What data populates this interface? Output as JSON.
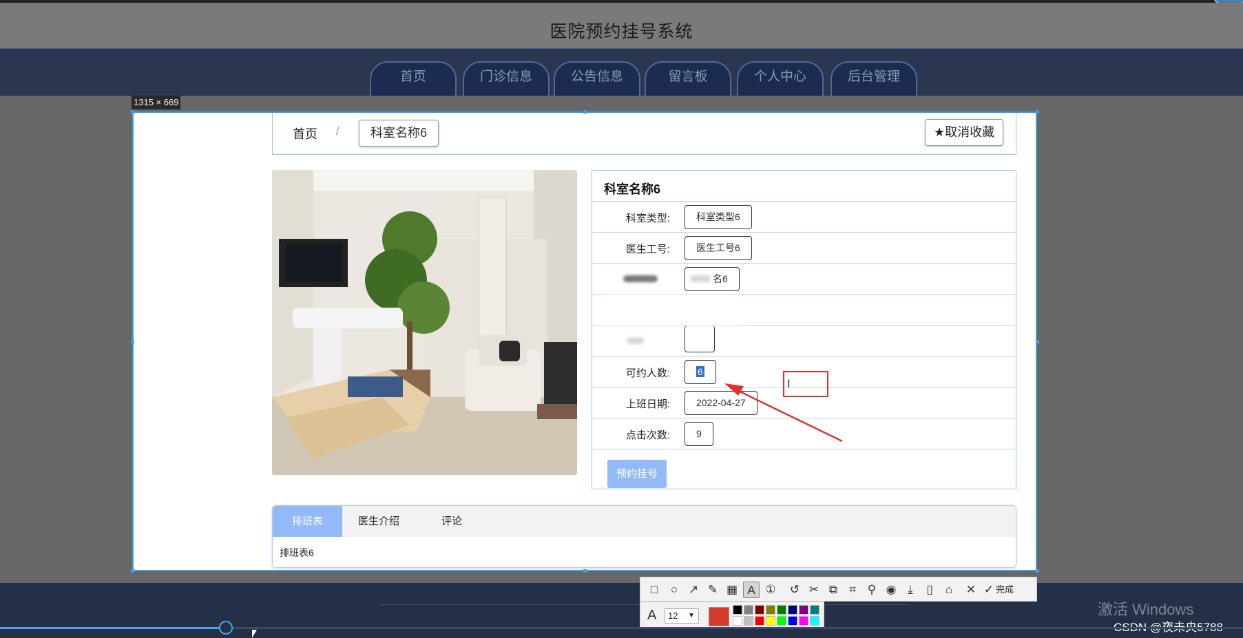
{
  "site": {
    "title": "医院预约挂号系统"
  },
  "nav": [
    "首页",
    "门诊信息",
    "公告信息",
    "留言板",
    "个人中心",
    "后台管理"
  ],
  "selection": {
    "size_label": "1315 × 669"
  },
  "breadcrumb": {
    "home": "首页",
    "separator": "/",
    "current": "科室名称6"
  },
  "favorite_button": {
    "icon": "★",
    "label": "取消收藏"
  },
  "detail": {
    "title": "科室名称6",
    "fields": [
      {
        "label": "科室类型:",
        "value": "科室类型6"
      },
      {
        "label": "医生工号:",
        "value": "医生工号6"
      },
      {
        "label": "",
        "value": "名6"
      },
      {
        "label": "",
        "value": ""
      },
      {
        "label": "",
        "value": ""
      },
      {
        "label": "可约人数:",
        "value": "6"
      },
      {
        "label": "上班日期:",
        "value": "2022-04-27"
      },
      {
        "label": "点击次数:",
        "value": "9"
      }
    ],
    "book_button": "预约挂号"
  },
  "tabs": {
    "items": [
      "排班表",
      "医生介绍",
      "评论"
    ],
    "active_content": "排班表6"
  },
  "annotation": {
    "cursor_glyph": "I"
  },
  "toolbar": {
    "icons": [
      "rectangle-tool-icon",
      "ellipse-tool-icon",
      "arrow-tool-icon",
      "pencil-tool-icon",
      "mosaic-tool-icon",
      "text-tool-icon",
      "number-tool-icon",
      "undo-icon",
      "cut-icon",
      "copy-icon",
      "ocr-icon",
      "pin-icon",
      "record-icon",
      "download-icon",
      "phone-icon",
      "bookmark-icon",
      "close-icon",
      "check-icon"
    ],
    "done_label": "完成",
    "font_size": "12"
  },
  "colors": {
    "accent": "#93b9f7",
    "selection_border": "#3aa0e8",
    "annotation_red": "#e03030",
    "current_color": "#d63a2a",
    "palette": [
      "#000000",
      "#808080",
      "#800000",
      "#808000",
      "#008000",
      "#000080",
      "#800080",
      "#008080",
      "#ffffff",
      "#c0c0c0",
      "#ff0000",
      "#ffff00",
      "#00ff00",
      "#0000ff",
      "#ff00ff",
      "#00ffff"
    ]
  },
  "watermark": {
    "windows": "激活 Windows",
    "csdn": "CSDN @夜未央5788"
  }
}
